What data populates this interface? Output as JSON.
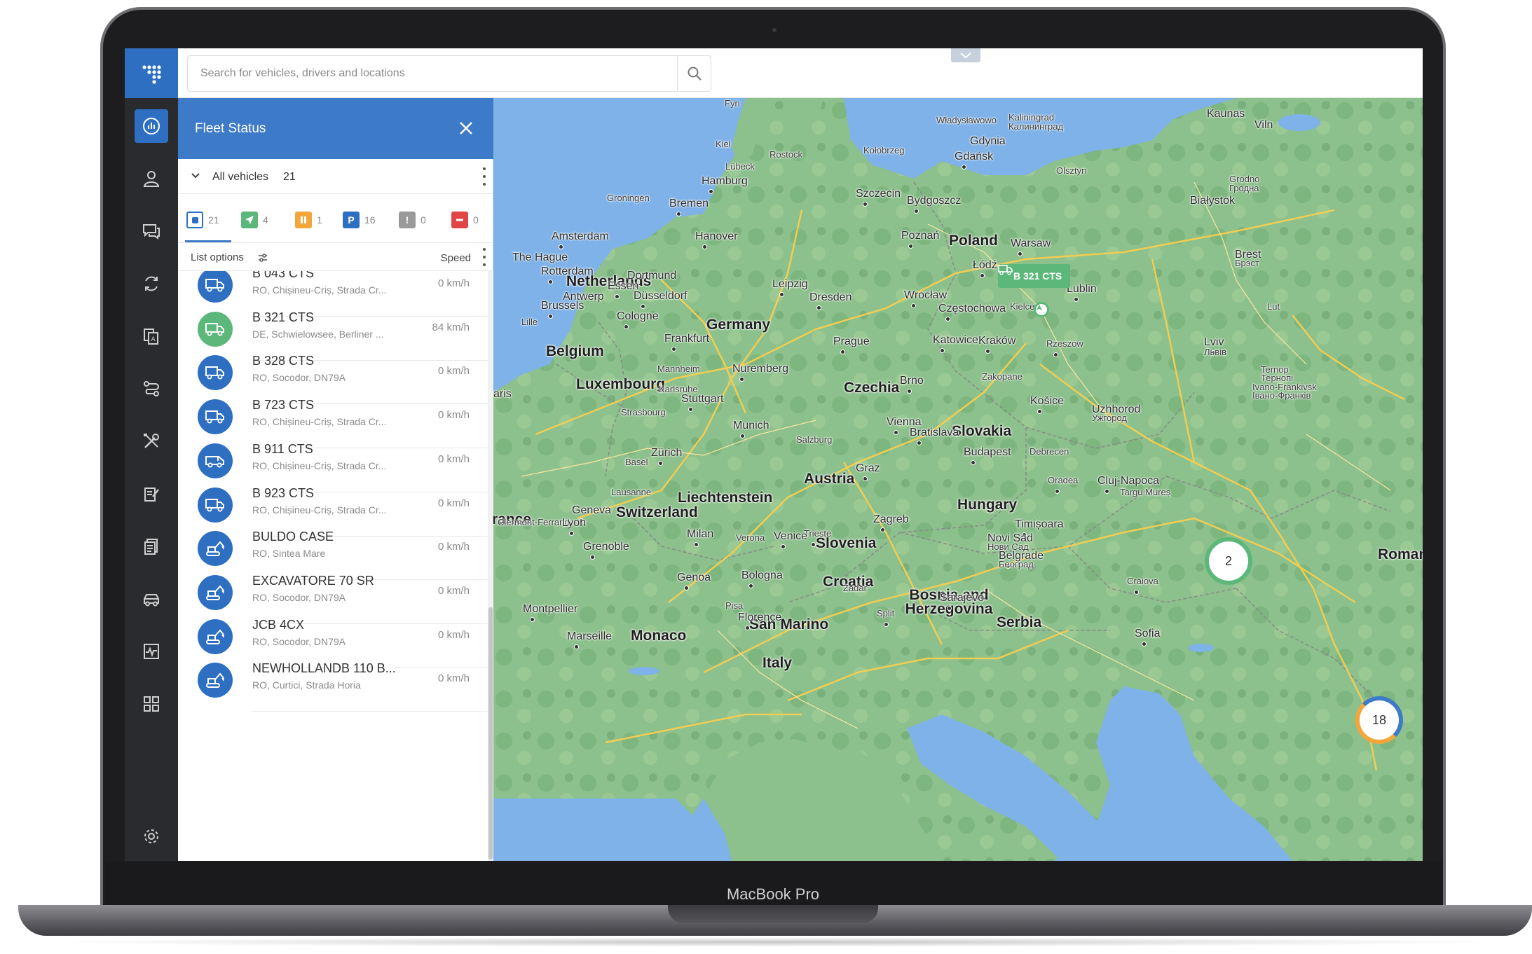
{
  "device": {
    "label": "MacBook Pro"
  },
  "search": {
    "placeholder": "Search for vehicles, drivers and locations"
  },
  "panel": {
    "title": "Fleet Status",
    "group_label": "All vehicles",
    "group_count": "21",
    "list_options_label": "List options",
    "speed_label": "Speed"
  },
  "filters": [
    {
      "name": "all",
      "count": "21",
      "color": "#2e6fc1"
    },
    {
      "name": "moving",
      "count": "4",
      "color": "#5cb87a"
    },
    {
      "name": "idle",
      "count": "1",
      "color": "#f3a73a"
    },
    {
      "name": "parked",
      "count": "16",
      "color": "#2e6fc1"
    },
    {
      "name": "alert",
      "count": "0",
      "color": "#9a9a9a"
    },
    {
      "name": "stopped",
      "count": "0",
      "color": "#e04646"
    }
  ],
  "vehicles": [
    {
      "name": "B 043 CTS",
      "address": "RO, Chișineu-Criș, Strada Cr...",
      "speed": "0 km/h",
      "icon": "truck-icon",
      "color": "#2e6fc1"
    },
    {
      "name": "B 321 CTS",
      "address": "DE, Schwielowsee, Berliner ...",
      "speed": "84 km/h",
      "icon": "truck-icon",
      "color": "#5cb87a"
    },
    {
      "name": "B 328 CTS",
      "address": "RO, Socodor, DN79A",
      "speed": "0 km/h",
      "icon": "truck-icon",
      "color": "#2e6fc1"
    },
    {
      "name": "B 723 CTS",
      "address": "RO, Chișineu-Criș, Strada Cr...",
      "speed": "0 km/h",
      "icon": "truck-icon",
      "color": "#2e6fc1"
    },
    {
      "name": "B 911 CTS",
      "address": "RO, Chișineu-Criș, Strada Cr...",
      "speed": "0 km/h",
      "icon": "van-icon",
      "color": "#2e6fc1"
    },
    {
      "name": "B 923 CTS",
      "address": "RO, Chișineu-Criș, Strada Cr...",
      "speed": "0 km/h",
      "icon": "truck-icon",
      "color": "#2e6fc1"
    },
    {
      "name": "BULDO CASE",
      "address": "RO, Sintea Mare",
      "speed": "0 km/h",
      "icon": "excavator-icon",
      "color": "#2e6fc1"
    },
    {
      "name": "EXCAVATORE 70 SR",
      "address": "RO, Socodor, DN79A",
      "speed": "0 km/h",
      "icon": "excavator-icon",
      "color": "#2e6fc1"
    },
    {
      "name": "JCB 4CX",
      "address": "RO, Socodor, DN79A",
      "speed": "0 km/h",
      "icon": "excavator-icon",
      "color": "#2e6fc1"
    },
    {
      "name": "NEWHOLLANDB 110 B...",
      "address": "RO, Curtici, Strada Horia",
      "speed": "0 km/h",
      "icon": "excavator-icon",
      "color": "#2e6fc1"
    }
  ],
  "map": {
    "vehicle_tag": "B 321 CTS",
    "clusters": [
      {
        "count": "2",
        "color": "#5cb87a"
      },
      {
        "count": "18",
        "color": "#3d7ac7"
      }
    ],
    "countries": [
      "Netherlands",
      "Belgium",
      "Luxembourg",
      "Germany",
      "Czechia",
      "Poland",
      "Slovakia",
      "Austria",
      "Liechtenstein",
      "Switzerland",
      "Hungary",
      "Slovenia",
      "Croatia",
      "Bosnia and Herzegovina",
      "Serbia",
      "Monaco",
      "San Marino",
      "Italy",
      "rance",
      "Roman"
    ],
    "cities": [
      "Fyn",
      "Kiel",
      "Lübeck",
      "Rostock",
      "Kołobrzeg",
      "Władysławowo",
      "Kaliningrad",
      "Калининград",
      "Kaunas",
      "Viln",
      "Gdynia",
      "Gdańsk",
      "Olsztyn",
      "Hamburg",
      "Groningen",
      "Bremen",
      "Szczecin",
      "Bydgoszcz",
      "Grodno",
      "Гродна",
      "Białystok",
      "Amsterdam",
      "Hanover",
      "Poznań",
      "Warsaw",
      "Brest",
      "Брэст",
      "The Hague",
      "Rotterdam",
      "Dortmund",
      "Essen",
      "Düsseldorf",
      "Antwerp",
      "Brussels",
      "Cologne",
      "Lille",
      "Leipzig",
      "Dresden",
      "Wrocław",
      "Łódź",
      "Lublin",
      "Częstochowa",
      "Kielce",
      "Lut",
      "Frankfurt",
      "Prague",
      "Katowice",
      "Kraków",
      "Rzeszów",
      "Lviv",
      "Львів",
      "Mannheim",
      "Nuremberg",
      "Karlsruhe",
      "Stuttgart",
      "Brno",
      "Zakopane",
      "Ternop",
      "Тернопі",
      "Ivano-Frankivsk",
      "Івано-Франків",
      "Košice",
      "Uzhhorod",
      "Ужгород",
      "aris",
      "Strasbourg",
      "Munich",
      "Vienna",
      "Bratislava",
      "Salzburg",
      "Zürich",
      "Basel",
      "Budapest",
      "Debrecen",
      "Graz",
      "Oradea",
      "Cluj-Napoca",
      "Lausanne",
      "Geneva",
      "Clermont-Ferrand",
      "Lyon",
      "Targu Mureș",
      "Zagreb",
      "Trieste",
      "Verona",
      "Venice",
      "Milan",
      "Timișoara",
      "Grenoble",
      "Novi Sad",
      "Нови Сад",
      "Belgrade",
      "Београд",
      "Genoa",
      "Bologna",
      "Zadar",
      "Sarajevo",
      "Craiova",
      "Montpellier",
      "Pisa",
      "Florence",
      "Split",
      "Marseille",
      "Sofia"
    ]
  }
}
